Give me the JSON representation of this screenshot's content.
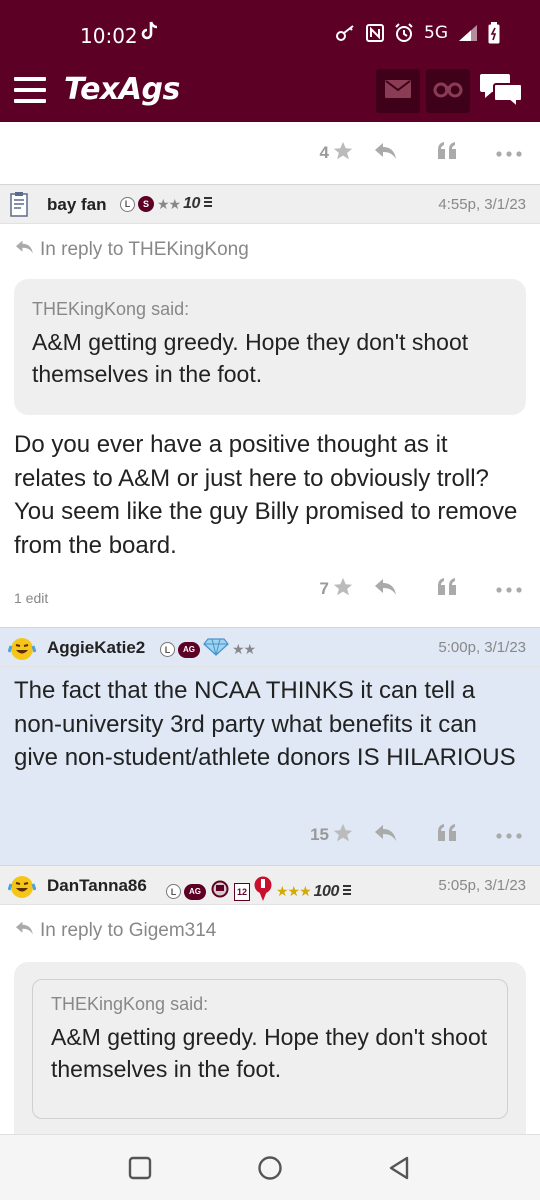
{
  "status_bar": {
    "time": "10:02",
    "network": "5G",
    "icons": [
      "tiktok-icon",
      "key-icon",
      "nfc-icon",
      "alarm-icon",
      "signal-icon",
      "battery-icon"
    ]
  },
  "app_bar": {
    "logo": "TexAgs",
    "icons": [
      "menu-icon",
      "mail-icon",
      "binoculars-icon",
      "chat-icon"
    ],
    "colors": {
      "brand": "#5d0025",
      "button_bg": "#3f0019"
    }
  },
  "prev_post": {
    "likes": "4"
  },
  "posts": [
    {
      "username": "bay fan",
      "badges": [
        "L",
        "S"
      ],
      "stars": "★★",
      "tier": "10",
      "timestamp": "4:55p, 3/1/23",
      "reply_to": "In reply to THEKingKong",
      "quote_author": "THEKingKong said:",
      "quote_text": "A&M getting greedy. Hope they don't shoot themselves in the foot.",
      "body": "Do you ever have a positive thought as it relates to A&M or just here to obviously troll? You seem like the guy Billy promised to remove from the board.",
      "edits": "1 edit",
      "likes": "7"
    },
    {
      "username": "AggieKatie2",
      "badges": [
        "L",
        "AG"
      ],
      "stars": "★★",
      "timestamp": "5:00p, 3/1/23",
      "body": "The fact that the NCAA THINKS it can tell a non-university 3rd party what benefits it can give non-student/athlete donors IS HILARIOUS",
      "likes": "15",
      "highlight_color": "#dfe8f4"
    },
    {
      "username": "DanTanna86",
      "badges": [
        "L",
        "AG",
        "12"
      ],
      "stars": "★★★",
      "tier": "100",
      "timestamp": "5:05p, 3/1/23",
      "reply_to": "In reply to Gigem314",
      "quote_author": "THEKingKong said:",
      "quote_text": "A&M getting greedy. Hope they don't shoot themselves in the foot."
    }
  ],
  "nav_bar": {
    "icons": [
      "recents-icon",
      "home-icon",
      "back-icon"
    ]
  }
}
